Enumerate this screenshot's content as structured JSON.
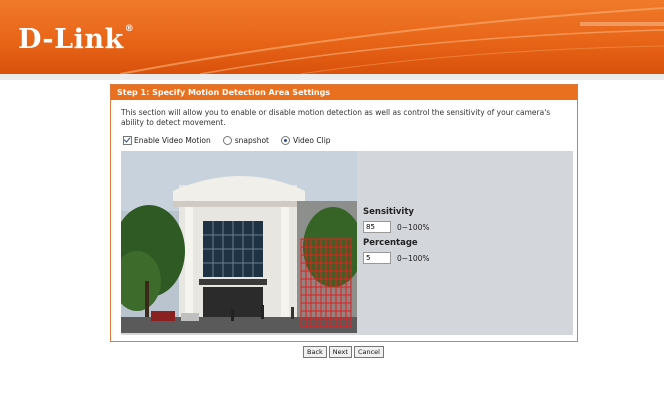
{
  "brand": {
    "logo": "D-Link",
    "trademark": "®"
  },
  "step": {
    "title": "Step 1: Specify Motion Detection Area Settings",
    "description": "This section will allow you to enable or disable motion detection as well as control the sensitivity of your camera's ability to detect movement."
  },
  "options": {
    "enable_video_motion": {
      "label": "Enable Video Motion",
      "checked": true
    },
    "snapshot": {
      "label": "snapshot",
      "selected": false
    },
    "video_clip": {
      "label": "Video Clip",
      "selected": true
    }
  },
  "sensitivity": {
    "label": "Sensitivity",
    "value": "85",
    "range": "0~100%"
  },
  "percentage": {
    "label": "Percentage",
    "value": "5",
    "range": "0~100%"
  },
  "buttons": {
    "back": "Back",
    "next": "Next",
    "cancel": "Cancel"
  },
  "colors": {
    "accent": "#e8701e",
    "grid": "#e02020",
    "panel_bg": "#d3d6db"
  }
}
